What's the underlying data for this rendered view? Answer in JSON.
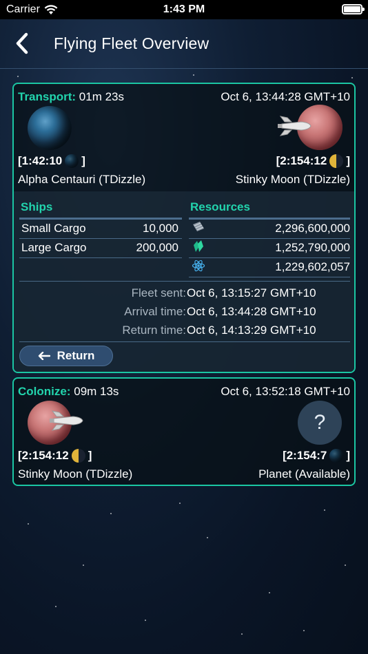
{
  "status_bar": {
    "carrier": "Carrier",
    "time": "1:43 PM"
  },
  "nav": {
    "title": "Flying Fleet Overview"
  },
  "fleets": [
    {
      "mission": "Transport:",
      "remaining": "01m 23s",
      "arrival_header": "Oct 6, 13:44:28 GMT+10",
      "origin": {
        "coords": "[1:42:10",
        "coords_end": "]",
        "name": "Alpha Centauri (TDizzle)"
      },
      "destination": {
        "coords": "[2:154:12",
        "coords_end": "]",
        "name": "Stinky Moon (TDizzle)"
      },
      "ships_title": "Ships",
      "ships": [
        {
          "name": "Small Cargo",
          "count": "10,000"
        },
        {
          "name": "Large Cargo",
          "count": "200,000"
        }
      ],
      "resources_title": "Resources",
      "resources": [
        {
          "icon": "metal-icon",
          "amount": "2,296,600,000"
        },
        {
          "icon": "crystal-icon",
          "amount": "1,252,790,000"
        },
        {
          "icon": "deuterium-icon",
          "amount": "1,229,602,057"
        }
      ],
      "times": [
        {
          "label": "Fleet sent:",
          "value": "Oct 6, 13:15:27 GMT+10"
        },
        {
          "label": "Arrival time:",
          "value": "Oct 6, 13:44:28 GMT+10"
        },
        {
          "label": "Return time:",
          "value": "Oct 6, 14:13:29 GMT+10"
        }
      ],
      "return_label": "Return"
    },
    {
      "mission": "Colonize:",
      "remaining": "09m 13s",
      "arrival_header": "Oct 6, 13:52:18 GMT+10",
      "origin": {
        "coords": "[2:154:12",
        "coords_end": "]",
        "name": "Stinky Moon (TDizzle)"
      },
      "destination": {
        "coords": "[2:154:7",
        "coords_end": "]",
        "name": "Planet (Available)",
        "unknown_symbol": "?"
      }
    }
  ],
  "colors": {
    "accent": "#22d4ad",
    "card_border": "#1bc6a3",
    "button": "#2f4d70"
  }
}
